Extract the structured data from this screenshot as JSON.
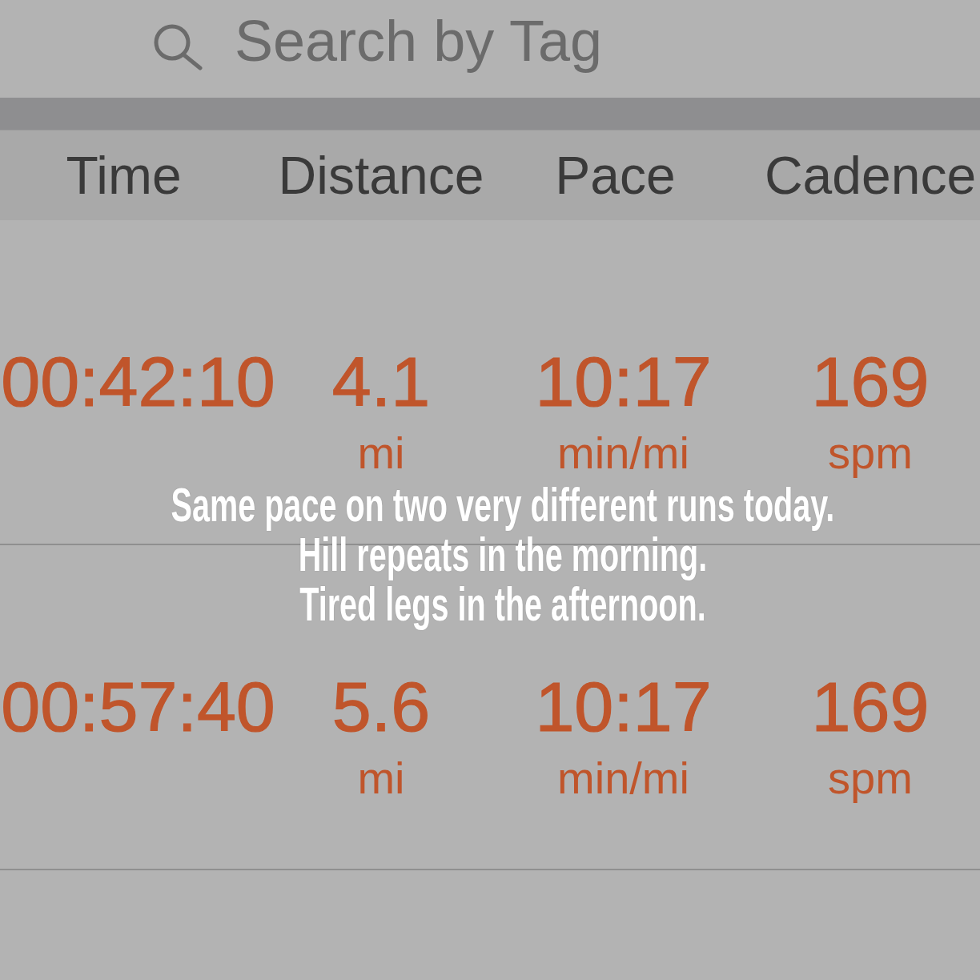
{
  "search": {
    "placeholder": "Search by Tag"
  },
  "table": {
    "columns": [
      "Time",
      "Distance",
      "Pace",
      "Cadence"
    ],
    "rows": [
      {
        "cells": [
          {
            "value": "00:42:10"
          },
          {
            "value": "4.1",
            "unit": "mi"
          },
          {
            "value": "10:17",
            "unit": "min/mi"
          },
          {
            "value": "169",
            "unit": "spm"
          }
        ]
      },
      {
        "cells": [
          {
            "value": "00:57:40"
          },
          {
            "value": "5.6",
            "unit": "mi"
          },
          {
            "value": "10:17",
            "unit": "min/mi"
          },
          {
            "value": "169",
            "unit": "spm"
          }
        ]
      }
    ]
  },
  "caption": {
    "lines": [
      "Same pace on two very different runs today.",
      "Hill repeats in the morning.",
      "Tired legs in the afternoon."
    ]
  }
}
